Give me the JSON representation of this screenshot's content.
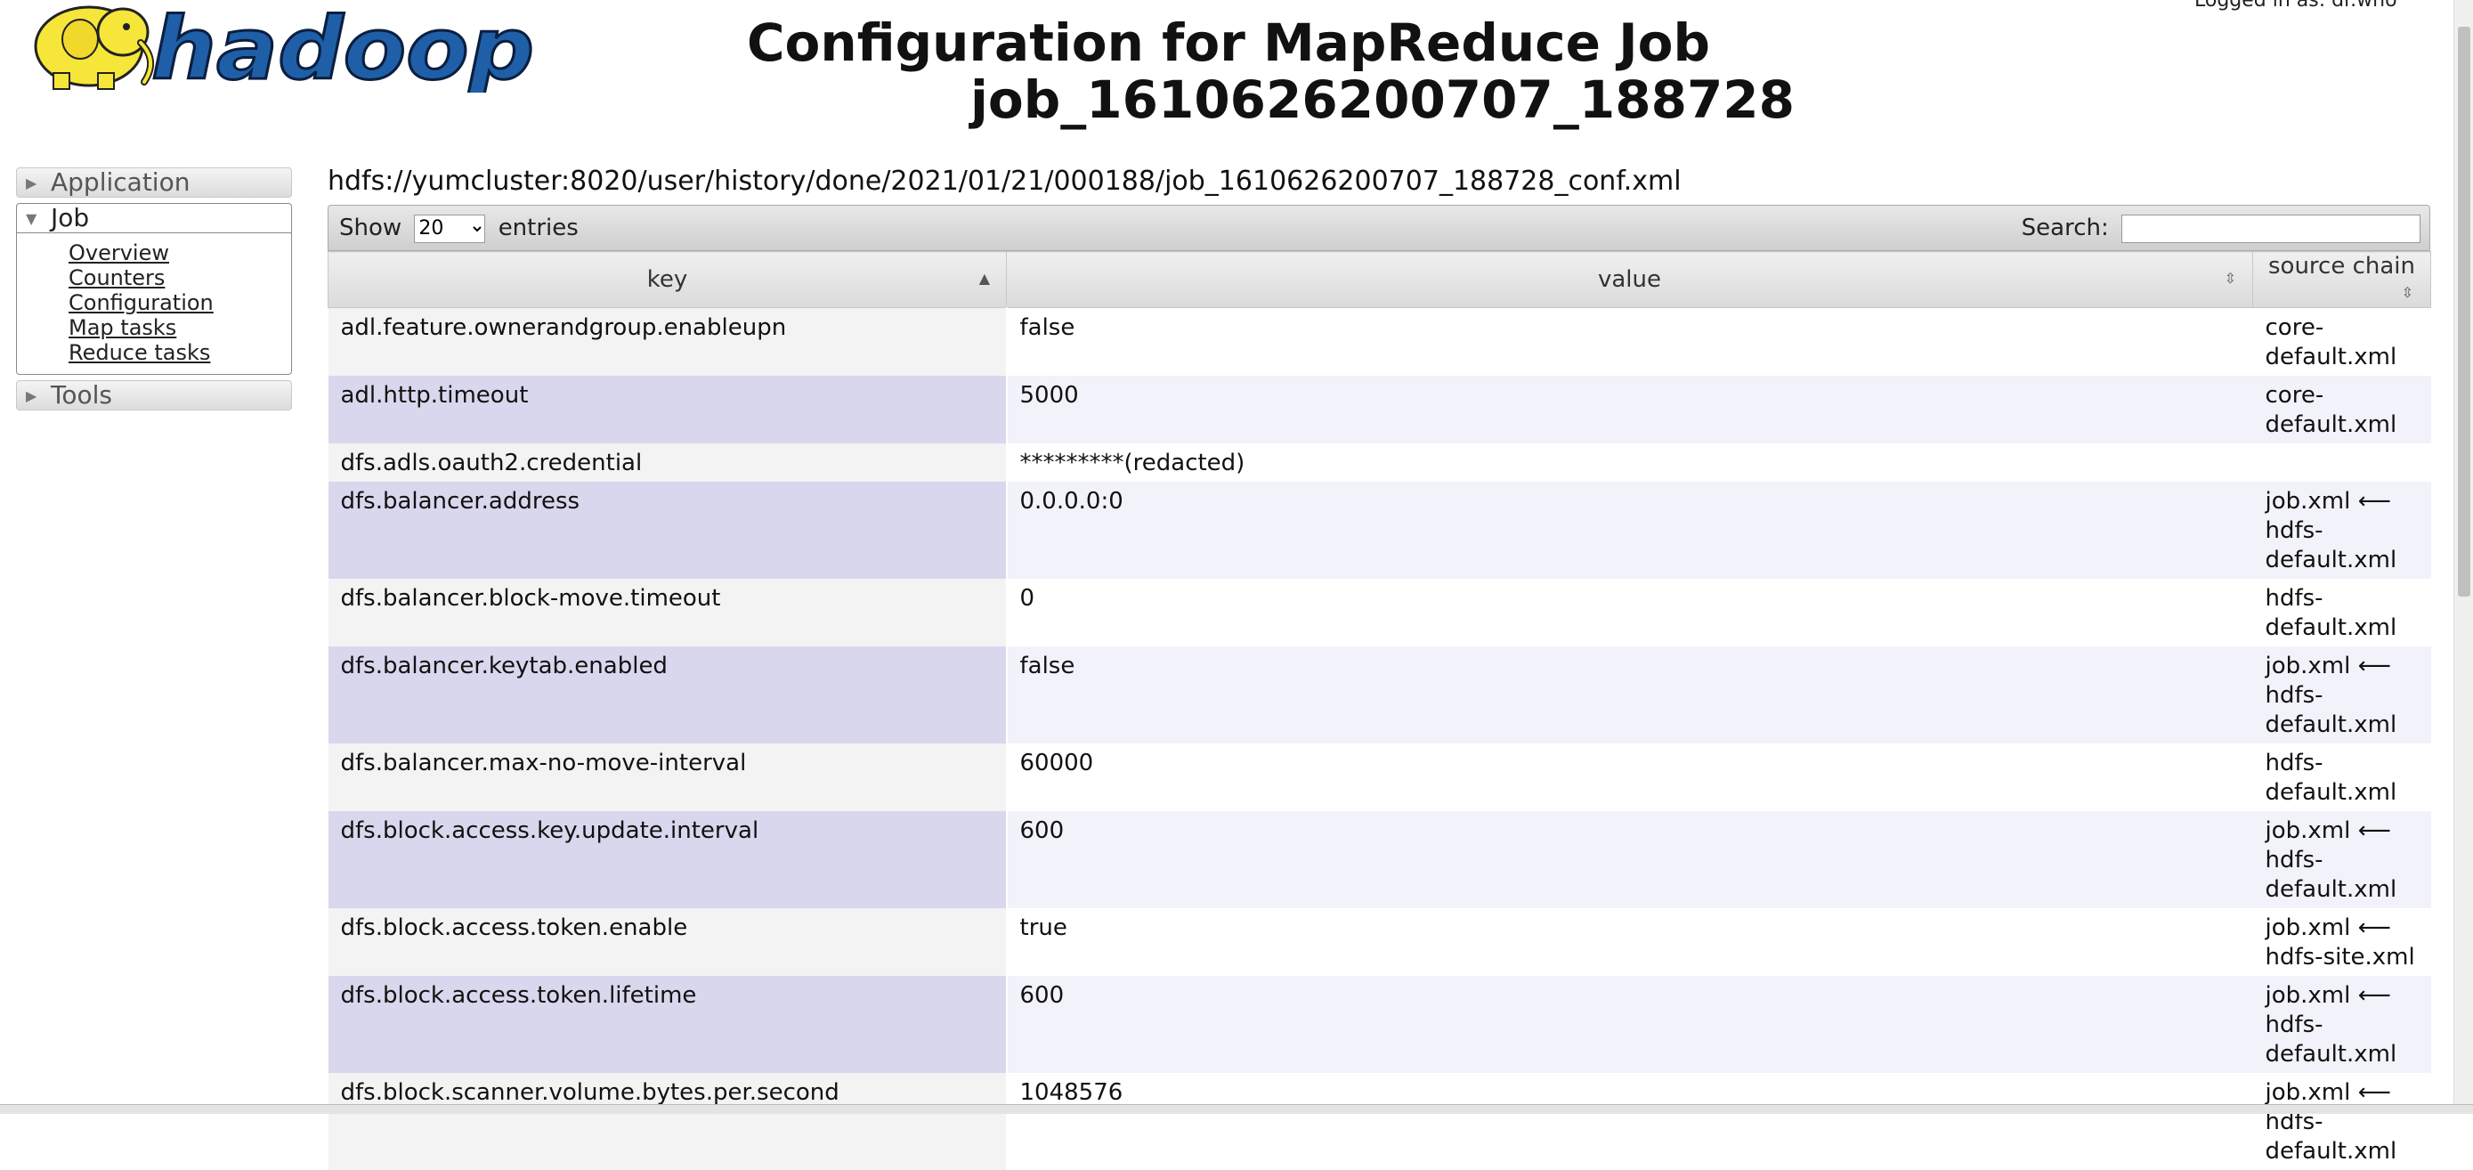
{
  "header": {
    "logo_text": "hadoop",
    "title_line1": "Configuration for MapReduce Job",
    "title_line2": "job_1610626200707_188728",
    "logged_in": "Logged in as: dr.who"
  },
  "sidebar": {
    "application": "Application",
    "job": "Job",
    "job_links": [
      "Overview",
      "Counters",
      "Configuration",
      "Map tasks",
      "Reduce tasks"
    ],
    "tools": "Tools"
  },
  "conf_path": "hdfs://yumcluster:8020/user/history/done/2021/01/21/000188/job_1610626200707_188728_conf.xml",
  "toolbar": {
    "show_label": "Show",
    "entries_value": "20",
    "entries_label": "entries",
    "search_label": "Search:"
  },
  "table": {
    "headers": [
      "key",
      "value",
      "source chain"
    ],
    "rows": [
      {
        "key": "adl.feature.ownerandgroup.enableupn",
        "value": "false",
        "source": "core-\ndefault.xml"
      },
      {
        "key": "adl.http.timeout",
        "value": "5000",
        "source": "core-\ndefault.xml"
      },
      {
        "key": "dfs.adls.oauth2.credential",
        "value": "*********(redacted)",
        "source": ""
      },
      {
        "key": "dfs.balancer.address",
        "value": "0.0.0.0:0",
        "source": "job.xml ⟵\nhdfs-\ndefault.xml"
      },
      {
        "key": "dfs.balancer.block-move.timeout",
        "value": "0",
        "source": "hdfs-\ndefault.xml"
      },
      {
        "key": "dfs.balancer.keytab.enabled",
        "value": "false",
        "source": "job.xml ⟵\nhdfs-\ndefault.xml"
      },
      {
        "key": "dfs.balancer.max-no-move-interval",
        "value": "60000",
        "source": "hdfs-\ndefault.xml"
      },
      {
        "key": "dfs.block.access.key.update.interval",
        "value": "600",
        "source": "job.xml ⟵\nhdfs-\ndefault.xml"
      },
      {
        "key": "dfs.block.access.token.enable",
        "value": "true",
        "source": "job.xml ⟵\nhdfs-site.xml"
      },
      {
        "key": "dfs.block.access.token.lifetime",
        "value": "600",
        "source": "job.xml ⟵\nhdfs-\ndefault.xml"
      },
      {
        "key": "dfs.block.scanner.volume.bytes.per.second",
        "value": "1048576",
        "source": "job.xml ⟵\nhdfs-\ndefault.xml"
      }
    ]
  },
  "colors": {
    "header_gradient_top": "#f0f0f0",
    "row_even_key": "#d9d7ed",
    "row_even_value": "#f2f2fb",
    "row_odd_key": "#f3f3f3",
    "logo_blue": "#1f5fa8",
    "logo_yellow": "#f6e63a"
  }
}
